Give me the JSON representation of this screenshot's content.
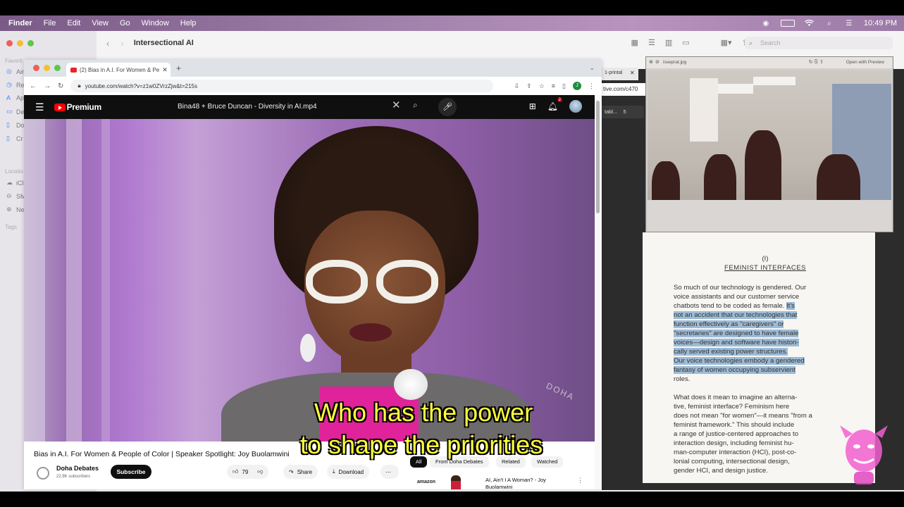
{
  "menubar": {
    "app": "Finder",
    "items": [
      "File",
      "Edit",
      "View",
      "Go",
      "Window",
      "Help"
    ],
    "clock": "10:49 PM"
  },
  "finder": {
    "title": "Intersectional AI",
    "search_placeholder": "Search",
    "sidebar": {
      "favorites_header": "Favorit",
      "favorites": [
        "Air",
        "Re",
        "Ap",
        "De",
        "Do",
        "Cr"
      ],
      "locations_header": "Locatio",
      "locations": [
        "iCl",
        "SM",
        "Ne"
      ],
      "tags_header": "Tags"
    }
  },
  "chrome": {
    "tab_title": "(2) Bias in A.I. For Women & Pe",
    "url": "youtube.com/watch?v=z1w0ZVrzZjw&t=215s",
    "profile_initial": "J"
  },
  "youtube": {
    "logo": "Premium",
    "search_query": "Bina48 + Bruce Duncan - Diversity in AI.mp4",
    "notification_count": "2",
    "video_title": "Bias in A.I. For Women & People of Color | Speaker Spotlight: Joy Buolamwini",
    "channel": "Doha Debates",
    "subscribers": "22.8K subscribers",
    "subscribe_label": "Subscribe",
    "likes": "79",
    "share_label": "Share",
    "download_label": "Download",
    "chips": [
      "All",
      "From Doha Debates",
      "Related",
      "Watched"
    ],
    "suggestion_title": "AI, Ain't I A Woman? - Joy Buolamwini",
    "suggestion_brand": "amazon",
    "watermark": "DOHA",
    "captions": [
      "Who has the power",
      "to shape the priorities"
    ]
  },
  "background_tab": {
    "tab": "1-printal",
    "url": "tive.com/c470",
    "pdf_toolbar": "tabl...",
    "page_number": "5"
  },
  "preview": {
    "filename": "isseprat.jpg",
    "open_with": "Open with Preview"
  },
  "pdf": {
    "section_number": "(I)",
    "heading": "FEMINIST INTERFACES",
    "lines": [
      {
        "text": "So much of our technology is gendered. Our",
        "hl": false
      },
      {
        "text": "voice assistants and our customer service",
        "hl": false
      },
      {
        "text": "chatbots tend to be coded as female. ",
        "hl_tail": "It's"
      },
      {
        "text": "not an accident that our technologies that",
        "hl": true
      },
      {
        "text": "function effectively as \"caregivers\" or",
        "hl": true
      },
      {
        "text": "\"secretaries\" are designed to have female",
        "hl": true
      },
      {
        "text": "voices—design and software have histori-",
        "hl": true
      },
      {
        "text": "cally served existing power structures.",
        "hl": true
      },
      {
        "text": "Our voice technologies embody a gendered",
        "hl": true
      },
      {
        "text": "fantasy of women occupying subservient",
        "hl": true
      },
      {
        "text": "roles.",
        "hl": false
      },
      {
        "text": "",
        "hl": false
      },
      {
        "text": "What does it mean to imagine an alterna-",
        "hl": false
      },
      {
        "text": "tive, feminist interface? Feminism here",
        "hl": false
      },
      {
        "text": "does not mean \"for women\"—it means \"from a",
        "hl": false
      },
      {
        "text": "feminist framework.\" This should include",
        "hl": false
      },
      {
        "text": "a range of justice-centered approaches to",
        "hl": false
      },
      {
        "text": "interaction design, including feminist hu-",
        "hl": false
      },
      {
        "text": "man-computer interaction (HCI), post-co-",
        "hl": false
      },
      {
        "text": "lonial computing, intersectional design,",
        "hl": false
      },
      {
        "text": "gender HCI, and design justice.",
        "hl": false
      }
    ]
  },
  "colors": {
    "caption": "#ffff3c",
    "highlight": "#9dbbd6",
    "youtube_red": "#ff0000"
  }
}
